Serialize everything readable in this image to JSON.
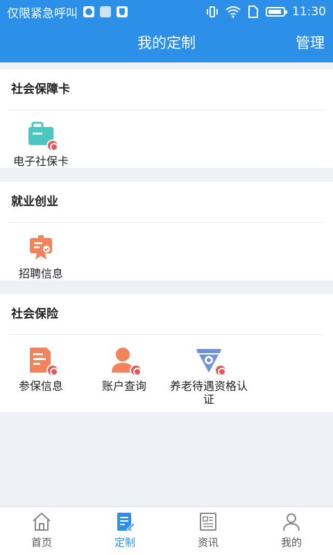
{
  "status_bar": {
    "carrier": "仅限紧急呼叫",
    "time": "11:30"
  },
  "header": {
    "title": "我的定制",
    "manage_label": "管理"
  },
  "sections": [
    {
      "title": "社会保障卡",
      "items": [
        {
          "label": "电子社保卡",
          "icon": "social-security-card-icon",
          "color": "#4cc6c1"
        }
      ]
    },
    {
      "title": "就业创业",
      "items": [
        {
          "label": "招聘信息",
          "icon": "recruitment-icon",
          "color": "#f3835b"
        }
      ]
    },
    {
      "title": "社会保险",
      "items": [
        {
          "label": "参保信息",
          "icon": "insurance-document-icon",
          "color": "#f3835b"
        },
        {
          "label": "账户查询",
          "icon": "account-person-icon",
          "color": "#f3835b"
        },
        {
          "label": "养老待遇资格认证",
          "icon": "pension-certification-icon",
          "color": "#6f8fe0"
        }
      ]
    }
  ],
  "bottom_nav": [
    {
      "label": "首页",
      "icon": "home-icon",
      "active": false
    },
    {
      "label": "定制",
      "icon": "customize-icon",
      "active": true
    },
    {
      "label": "资讯",
      "icon": "news-icon",
      "active": false
    },
    {
      "label": "我的",
      "icon": "profile-icon",
      "active": false
    }
  ],
  "colors": {
    "primary": "#2c8fe8",
    "background": "#eef1f5",
    "badge": "#e8555b"
  }
}
